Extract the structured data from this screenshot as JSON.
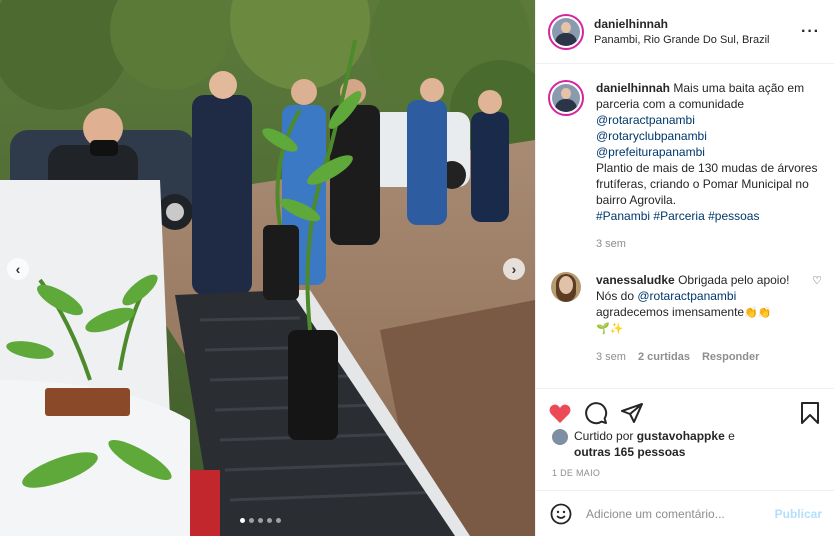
{
  "post": {
    "username": "danielhinnah",
    "location": "Panambi, Rio Grande Do Sul, Brazil",
    "more_icon": "more-options-icon"
  },
  "caption": {
    "username": "danielhinnah",
    "text_1": "Mais uma baita ação em parceria com a comunidade",
    "mentions": [
      "@rotaractpanambi",
      "@rotaryclubpanambi",
      "@prefeiturapanambi"
    ],
    "text_2": "Plantio de mais de 130 mudas de árvores frutíferas, criando o Pomar Municipal no bairro Agrovila.",
    "hashtags": [
      "#Panambi",
      "#Parceria",
      "#pessoas"
    ],
    "time": "3 sem"
  },
  "reply": {
    "username": "vanessaludke",
    "text_1": "Obrigada pelo apoio! Nós do",
    "mention": "@rotaractpanambi",
    "text_2": "agradecemos imensamente",
    "emojis_1": "👏👏",
    "emojis_2": "🌱✨",
    "time": "3 sem",
    "likes": "2 curtidas",
    "reply_label": "Responder"
  },
  "likes": {
    "prefix": "Curtido por",
    "user": "gustavohappke",
    "connector": "e",
    "others": "outras 165 pessoas"
  },
  "date": "1 DE MAIO",
  "comment_box": {
    "placeholder": "Adicione um comentário...",
    "publish_label": "Publicar"
  },
  "colors": {
    "like_red": "#ed4956",
    "link_blue": "#00376b",
    "publish_disabled": "#b2dffc"
  },
  "carousel": {
    "slides": 5,
    "current": 1
  }
}
